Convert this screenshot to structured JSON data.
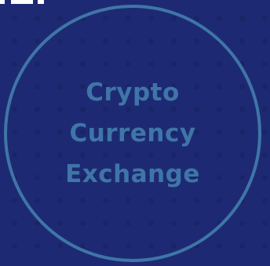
{
  "badge": {
    "lines": [
      "Crypto",
      "Currency",
      "Exchange"
    ]
  },
  "colors": {
    "background": "#1d2a73",
    "dot_pattern": "#192566",
    "accent": "#3f75a7",
    "corner_glyph": "#ffffff"
  },
  "icons": {
    "corner": "partial-white-glyph-icon",
    "ring": "circle-outline-icon"
  }
}
